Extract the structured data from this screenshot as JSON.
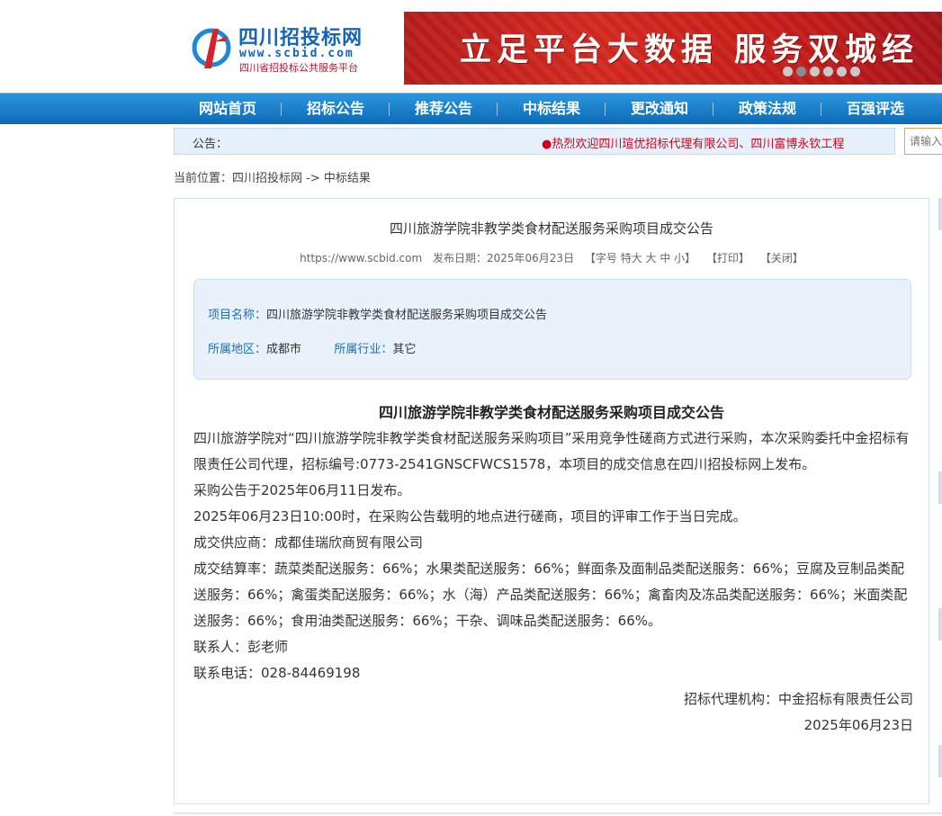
{
  "header": {
    "logo_title": "四川招投标网",
    "logo_url": "www.scbid.com",
    "logo_subtitle": "四川省招投标公共服务平台",
    "banner_text": "立足平台大数据  服务双城经",
    "banner_dots": 6,
    "banner_active_dot": 1,
    "brand_blue": "#1565b8",
    "brand_red": "#c8102e"
  },
  "nav": {
    "items": [
      "网站首页",
      "招标公告",
      "推荐公告",
      "中标结果",
      "更改通知",
      "政策法规",
      "百强评选"
    ]
  },
  "notice": {
    "label": "公告：",
    "text": "●热烈欢迎四川瑄优招标代理有限公司、四川富博永钦工程",
    "search_placeholder": "请输入"
  },
  "breadcrumb": "当前位置：四川招投标网 -> 中标结果",
  "article": {
    "title": "四川旅游学院非教学类食材配送服务采购项目成交公告",
    "meta": {
      "source": "https://www.scbid.com",
      "date": "发布日期：2025年06月23日",
      "font_size": "【字号  特大  大  中  小】",
      "print": "【打印】",
      "close": "【关闭】"
    },
    "info": {
      "project_key": "项目名称：",
      "project_val": "四川旅游学院非教学类食材配送服务采购项目成交公告",
      "region_key": "所属地区：",
      "region_val": "成都市",
      "industry_key": "所属行业：",
      "industry_val": "其它"
    },
    "body_title": "四川旅游学院非教学类食材配送服务采购项目成交公告",
    "paragraphs": [
      "四川旅游学院对“四川旅游学院非教学类食材配送服务采购项目”采用竞争性磋商方式进行采购，本次采购委托中金招标有限责任公司代理，招标编号:0773-2541GNSCFWCS1578，本项目的成交信息在四川招投标网上发布。",
      "采购公告于2025年06月11日发布。",
      "2025年06月23日10:00时，在采购公告载明的地点进行磋商，项目的评审工作于当日完成。",
      "成交供应商：成都佳瑞欣商贸有限公司",
      "成交结算率：蔬菜类配送服务：66%；水果类配送服务：66%；鲜面条及面制品类配送服务：66%；豆腐及豆制品类配送服务：66%；禽蛋类配送服务：66%；水（海）产品类配送服务：66%；禽畜肉及冻品类配送服务：66%；米面类配送服务：66%；食用油类配送服务：66%；干杂、调味品类配送服务：66%。",
      "联系人：彭老师",
      "联系电话：028-84469198"
    ],
    "agency": "招标代理机构：中金招标有限责任公司",
    "sign_date": "2025年06月23日"
  }
}
